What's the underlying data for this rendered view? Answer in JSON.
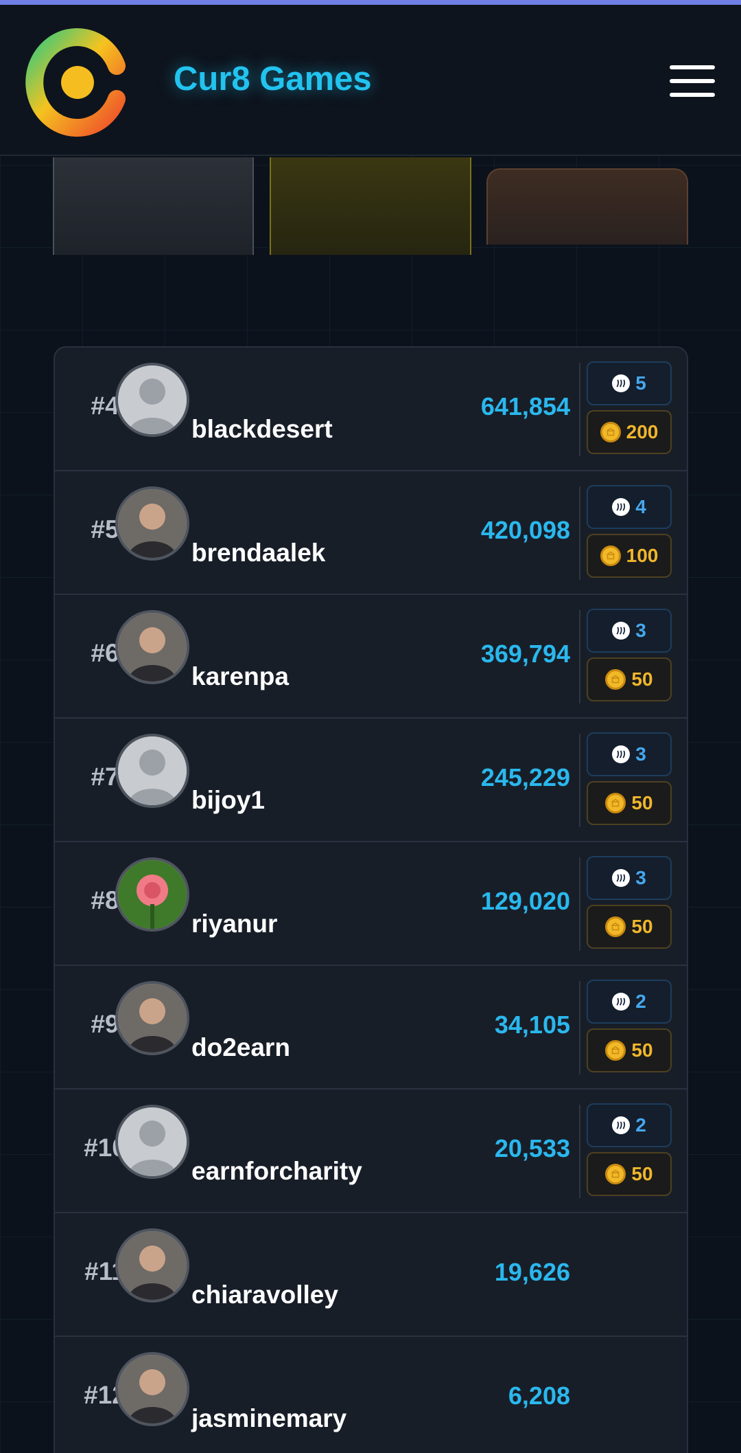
{
  "header": {
    "brand": "Cur8 Games",
    "logo": "cur8-logo",
    "menu_icon": "hamburger-menu-icon"
  },
  "colors": {
    "accent": "#22c3ef",
    "score": "#2ab8ee",
    "steem_badge": "#45a8ef",
    "coin_badge": "#f0b62c",
    "background": "#0c121c"
  },
  "leaderboard": {
    "rows": [
      {
        "rank": "#4",
        "username": "blackdesert",
        "score": "641,854",
        "steem": "5",
        "coins": "200",
        "avatar": "default-avatar"
      },
      {
        "rank": "#5",
        "username": "brendaalek",
        "score": "420,098",
        "steem": "4",
        "coins": "100",
        "avatar": "photo-avatar"
      },
      {
        "rank": "#6",
        "username": "karenpa",
        "score": "369,794",
        "steem": "3",
        "coins": "50",
        "avatar": "photo-avatar"
      },
      {
        "rank": "#7",
        "username": "bijoy1",
        "score": "245,229",
        "steem": "3",
        "coins": "50",
        "avatar": "default-avatar"
      },
      {
        "rank": "#8",
        "username": "riyanur",
        "score": "129,020",
        "steem": "3",
        "coins": "50",
        "avatar": "rose-avatar"
      },
      {
        "rank": "#9",
        "username": "do2earn",
        "score": "34,105",
        "steem": "2",
        "coins": "50",
        "avatar": "photo-avatar"
      },
      {
        "rank": "#10",
        "username": "earnforcharity",
        "score": "20,533",
        "steem": "2",
        "coins": "50",
        "avatar": "default-avatar"
      },
      {
        "rank": "#11",
        "username": "chiaravolley",
        "score": "19,626",
        "avatar": "photo-avatar"
      },
      {
        "rank": "#12",
        "username": "jasminemary",
        "score": "6,208",
        "avatar": "photo-avatar"
      }
    ]
  }
}
